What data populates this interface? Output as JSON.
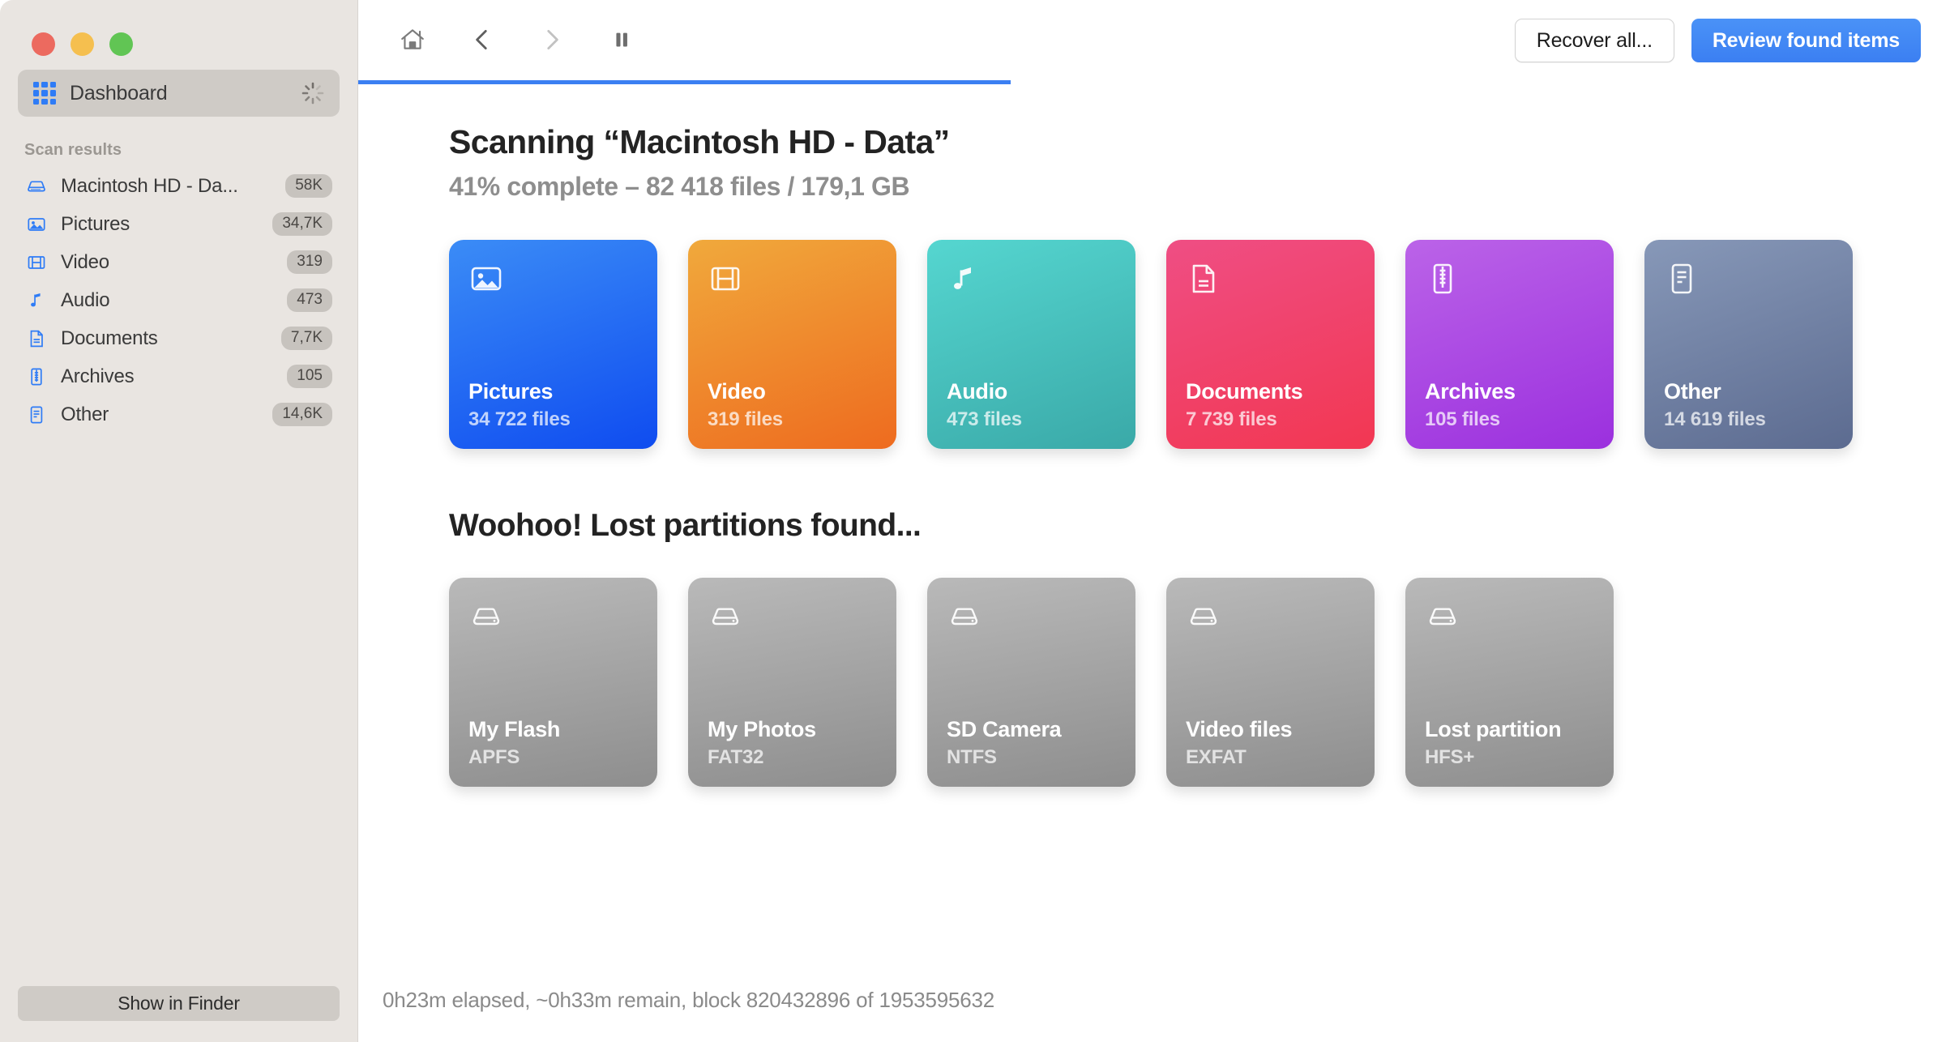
{
  "window": {
    "traffic_lights": [
      "close",
      "minimize",
      "maximize"
    ]
  },
  "sidebar": {
    "dashboard": {
      "label": "Dashboard",
      "icon": "grid-icon",
      "busy_icon": "spinner-icon",
      "selected": true
    },
    "section_title": "Scan results",
    "items": [
      {
        "label": "Macintosh HD - Da...",
        "badge": "58K",
        "icon": "harddisk-icon"
      },
      {
        "label": "Pictures",
        "badge": "34,7K",
        "icon": "picture-icon"
      },
      {
        "label": "Video",
        "badge": "319",
        "icon": "film-icon"
      },
      {
        "label": "Audio",
        "badge": "473",
        "icon": "music-note-icon"
      },
      {
        "label": "Documents",
        "badge": "7,7K",
        "icon": "document-icon"
      },
      {
        "label": "Archives",
        "badge": "105",
        "icon": "archive-zip-icon"
      },
      {
        "label": "Other",
        "badge": "14,6K",
        "icon": "list-document-icon"
      }
    ],
    "show_in_finder_label": "Show in Finder"
  },
  "toolbar": {
    "home_icon": "home-icon",
    "back_icon": "chevron-left-icon",
    "forward_icon": "chevron-right-icon",
    "pause_icon": "pause-icon",
    "recover_all_label": "Recover all...",
    "review_found_items_label": "Review found items"
  },
  "progress": {
    "percent": 41,
    "accent_color": "#3b7ff2"
  },
  "main": {
    "title": "Scanning “Macintosh HD - Data”",
    "subtitle": "41% complete – 82 418 files / 179,1 GB",
    "file_cards": [
      {
        "title": "Pictures",
        "count": "34 722 files",
        "icon": "picture-icon",
        "color_from": "#3B8CF6",
        "color_to": "#0F4CF0"
      },
      {
        "title": "Video",
        "count": "319 files",
        "icon": "film-icon",
        "color_from": "#F0A93C",
        "color_to": "#EE6B1F"
      },
      {
        "title": "Audio",
        "count": "473 files",
        "icon": "music-note-icon",
        "color_from": "#55D6D0",
        "color_to": "#3AA9A8"
      },
      {
        "title": "Documents",
        "count": "7 739 files",
        "icon": "document-icon",
        "color_from": "#EF4E84",
        "color_to": "#F23752"
      },
      {
        "title": "Archives",
        "count": "105 files",
        "icon": "archive-zip-icon",
        "color_from": "#BB63E8",
        "color_to": "#9B30DE"
      },
      {
        "title": "Other",
        "count": "14 619 files",
        "icon": "list-document-icon",
        "color_from": "#8798B8",
        "color_to": "#5C6B90"
      }
    ],
    "partitions_heading": "Woohoo! Lost partitions found...",
    "partition_cards": [
      {
        "title": "My Flash",
        "fs": "APFS",
        "icon": "harddisk-icon"
      },
      {
        "title": "My Photos",
        "fs": "FAT32",
        "icon": "harddisk-icon"
      },
      {
        "title": "SD Camera",
        "fs": "NTFS",
        "icon": "harddisk-icon"
      },
      {
        "title": "Video files",
        "fs": "EXFAT",
        "icon": "harddisk-icon"
      },
      {
        "title": "Lost partition",
        "fs": "HFS+",
        "icon": "harddisk-icon"
      }
    ],
    "status": "0h23m elapsed, ~0h33m remain, block 820432896 of 1953595632"
  }
}
